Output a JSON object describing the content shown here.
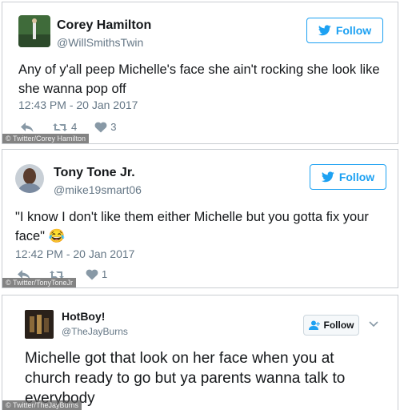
{
  "tweets": [
    {
      "name": "Corey Hamilton",
      "handle": "@WillSmithsTwin",
      "follow_label": "Follow",
      "text": "Any of y'all peep Michelle's face she ain't rocking she look like she wanna pop off",
      "time": "12:43 PM - 20 Jan 2017",
      "retweets": "4",
      "likes": "3",
      "credit": "© Twitter/Corey Hamilton"
    },
    {
      "name": "Tony Tone Jr.",
      "handle": "@mike19smart06",
      "follow_label": "Follow",
      "text": "\"I know I don't like them either Michelle but you gotta fix your face\"",
      "emoji": "😂",
      "time": "12:42 PM - 20 Jan 2017",
      "retweets": "",
      "likes": "1",
      "credit": "© Twitter/TonyToneJr"
    },
    {
      "name": "HotBoy!",
      "handle": "@TheJayBurns",
      "follow_label": "Follow",
      "text": "Michelle got that look on her face when you at church ready to go but ya parents wanna talk to everybody",
      "credit": "© Twitter/TheJayBurns"
    }
  ],
  "colors": {
    "twitter_blue": "#1da1f2",
    "muted": "#657786"
  },
  "icons": [
    "bird-icon",
    "reply-icon",
    "retweet-icon",
    "heart-icon",
    "add-user-icon",
    "chevron-down-icon"
  ]
}
